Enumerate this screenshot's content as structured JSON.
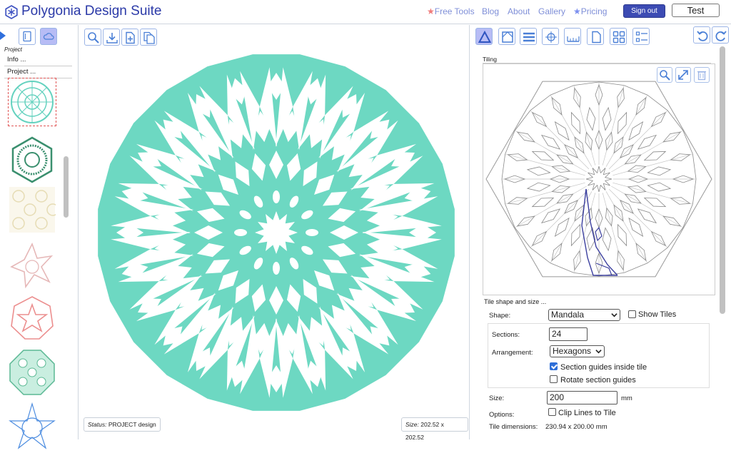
{
  "header": {
    "title": "Polygonia Design Suite",
    "nav": [
      {
        "label": "Free Tools",
        "star": true,
        "star_color": "#ef7b7b"
      },
      {
        "label": "Blog"
      },
      {
        "label": "About"
      },
      {
        "label": "Gallery"
      },
      {
        "label": "Pricing",
        "star": true,
        "star_color": "#7b8fef"
      }
    ],
    "signout_label": "Sign out",
    "user_label": "Test"
  },
  "left_panel": {
    "project_menu": {
      "title": "Project",
      "items": [
        "Info ...",
        "Project ..."
      ]
    },
    "thumbnails": [
      {
        "name": "mandala-teal",
        "color": "#64d2bf",
        "selected": true
      },
      {
        "name": "hexagon-green",
        "color": "#3a8f6e"
      },
      {
        "name": "floral-tile-beige",
        "color": "#e6dcb4"
      },
      {
        "name": "star-pink-light",
        "color": "#e6b8b8"
      },
      {
        "name": "star-pink",
        "color": "#ec8f8f"
      },
      {
        "name": "octagon-circles-green",
        "color": "#5bb894"
      },
      {
        "name": "star-blue",
        "color": "#4d8de0"
      }
    ]
  },
  "center_panel": {
    "status_label": "Status:",
    "status_value": "PROJECT design",
    "size_label": "Size:",
    "size_value": "202.52 x 202.52",
    "design_color": "#6dd8c2"
  },
  "right_panel": {
    "tiling_label": "Tiling",
    "tile_shape_size_label": "Tile shape and size ...",
    "shape_label": "Shape:",
    "shape_value": "Mandala",
    "show_tiles_label": "Show Tiles",
    "show_tiles_checked": false,
    "sections_label": "Sections:",
    "sections_value": "24",
    "arrangement_label": "Arrangement:",
    "arrangement_value": "Hexagons",
    "section_guides_label": "Section guides inside tile",
    "section_guides_checked": true,
    "rotate_guides_label": "Rotate section guides",
    "rotate_guides_checked": false,
    "size_label": "Size:",
    "size_value": "200",
    "size_unit": "mm",
    "options_label": "Options:",
    "clip_lines_label": "Clip Lines to Tile",
    "clip_lines_checked": false,
    "tile_dimensions_label": "Tile dimensions:",
    "tile_dimensions_value": "230.94 x 200.00",
    "tile_dimensions_unit": "mm",
    "accent_color": "#4a7fd6"
  }
}
